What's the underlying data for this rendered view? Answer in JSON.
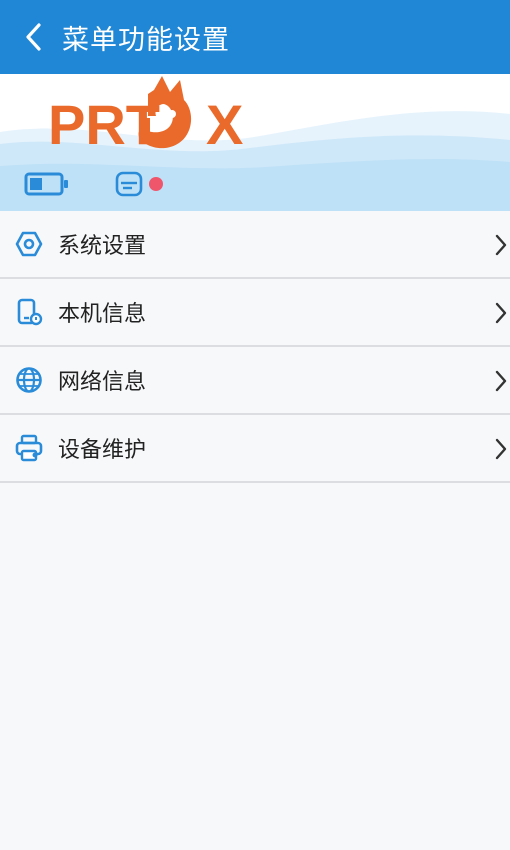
{
  "header": {
    "title": "菜单功能设置",
    "back_icon": "chevron-left-icon"
  },
  "banner": {
    "logo_text": "PRTFOX",
    "status_icons": [
      "battery-icon",
      "printer-status-icon"
    ],
    "status_dot_color": "#f0566b"
  },
  "menu": {
    "items": [
      {
        "label": "系统设置",
        "icon": "settings-hexagon-icon"
      },
      {
        "label": "本机信息",
        "icon": "device-info-icon"
      },
      {
        "label": "网络信息",
        "icon": "globe-icon"
      },
      {
        "label": "设备维护",
        "icon": "printer-maintenance-icon"
      }
    ]
  },
  "colors": {
    "header_bg": "#1f87d6",
    "icon_blue": "#2a8cd8",
    "logo_orange": "#e96a2a",
    "wave_light": "#dff0fb",
    "wave_mid": "#bfe1f7"
  }
}
